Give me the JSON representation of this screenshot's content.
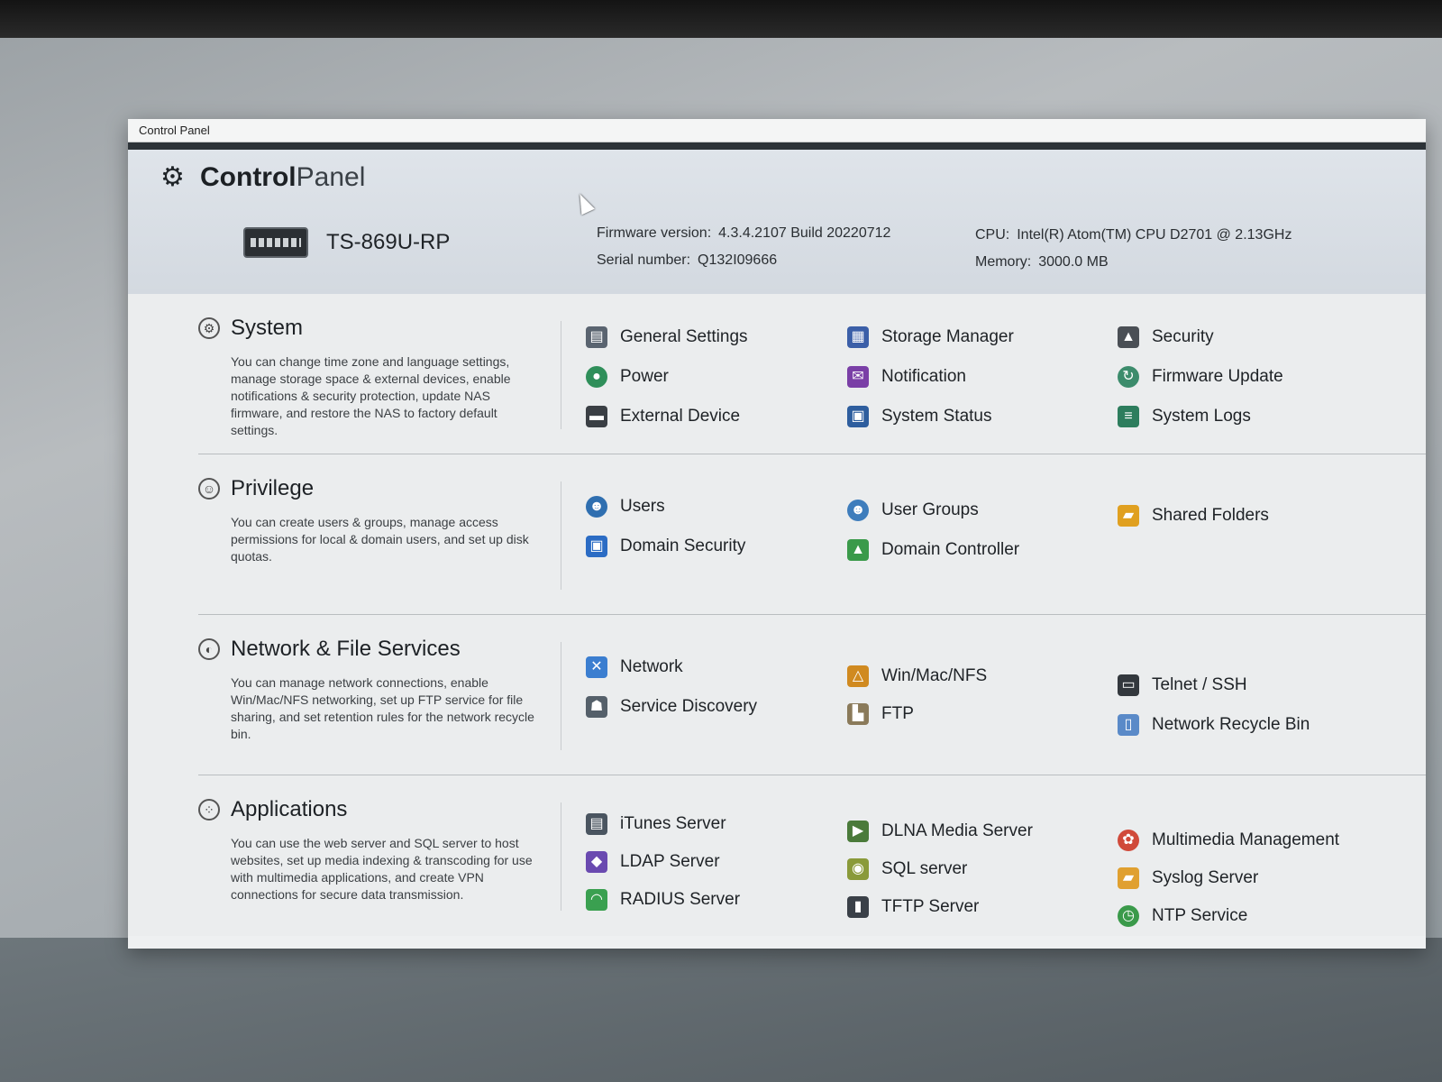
{
  "window": {
    "title": "Control Panel"
  },
  "header": {
    "app_title_bold": "Control",
    "app_title_light": "Panel",
    "device_name": "TS-869U-RP",
    "firmware_label": "Firmware version:",
    "firmware_value": "4.3.4.2107 Build 20220712",
    "serial_label": "Serial number:",
    "serial_value": "Q132I09666",
    "cpu_label": "CPU:",
    "cpu_value": "Intel(R) Atom(TM) CPU D2701 @ 2.13GHz",
    "memory_label": "Memory:",
    "memory_value": "3000.0 MB"
  },
  "sections": [
    {
      "title": "System",
      "icon": "gear-icon",
      "description": "You can change time zone and language settings, manage storage space & external devices, enable notifications & security protection, update NAS firmware, and restore the NAS to factory default settings.",
      "items": [
        {
          "label": "General Settings",
          "icon": "general-settings-icon",
          "color": "#5a6470"
        },
        {
          "label": "Power",
          "icon": "power-bulb-icon",
          "color": "#2f8f5a"
        },
        {
          "label": "External Device",
          "icon": "external-device-icon",
          "color": "#3a3f44"
        },
        {
          "label": "Storage Manager",
          "icon": "storage-manager-icon",
          "color": "#3b5fa8"
        },
        {
          "label": "Notification",
          "icon": "notification-icon",
          "color": "#7a3fa6"
        },
        {
          "label": "System Status",
          "icon": "system-status-icon",
          "color": "#2e5e9e"
        },
        {
          "label": "Security",
          "icon": "lock-icon",
          "color": "#4a4f55"
        },
        {
          "label": "Firmware Update",
          "icon": "firmware-update-icon",
          "color": "#3c8c6c"
        },
        {
          "label": "System Logs",
          "icon": "system-logs-icon",
          "color": "#2d7d5d"
        }
      ]
    },
    {
      "title": "Privilege",
      "icon": "user-outline-icon",
      "description": "You can create users & groups, manage access permissions for local & domain users, and set up disk quotas.",
      "items": [
        {
          "label": "Users",
          "icon": "users-icon",
          "color": "#2f6fb0"
        },
        {
          "label": "Domain Security",
          "icon": "domain-security-icon",
          "color": "#2b6cc4"
        },
        {
          "label": "User Groups",
          "icon": "user-groups-icon",
          "color": "#3e7dbc"
        },
        {
          "label": "Domain Controller",
          "icon": "domain-controller-icon",
          "color": "#3a9a4a"
        },
        {
          "label": "Shared Folders",
          "icon": "shared-folders-icon",
          "color": "#e0a020"
        }
      ]
    },
    {
      "title": "Network & File Services",
      "icon": "globe-icon",
      "description": "You can manage network connections, enable Win/Mac/NFS networking, set up FTP service for file sharing, and set retention rules for the network recycle bin.",
      "items": [
        {
          "label": "Network",
          "icon": "network-icon",
          "color": "#3b7ed0"
        },
        {
          "label": "Service Discovery",
          "icon": "service-discovery-icon",
          "color": "#55606a"
        },
        {
          "label": "Win/Mac/NFS",
          "icon": "win-mac-nfs-icon",
          "color": "#d08a20"
        },
        {
          "label": "FTP",
          "icon": "ftp-icon",
          "color": "#8a7a5a"
        },
        {
          "label": "Telnet / SSH",
          "icon": "terminal-icon",
          "color": "#33383d"
        },
        {
          "label": "Network Recycle Bin",
          "icon": "recycle-bin-icon",
          "color": "#5a8ac8"
        }
      ]
    },
    {
      "title": "Applications",
      "icon": "apps-grid-icon",
      "description": "You can use the web server and SQL server to host websites, set up media indexing & transcoding for use with multimedia applications, and create VPN connections for secure data transmission.",
      "items": [
        {
          "label": "iTunes Server",
          "icon": "itunes-server-icon",
          "color": "#4a5560"
        },
        {
          "label": "LDAP Server",
          "icon": "ldap-server-icon",
          "color": "#6a4ab0"
        },
        {
          "label": "RADIUS Server",
          "icon": "radius-server-icon",
          "color": "#3aa050"
        },
        {
          "label": "DLNA Media Server",
          "icon": "dlna-media-server-icon",
          "color": "#4a7a3a"
        },
        {
          "label": "SQL server",
          "icon": "sql-server-icon",
          "color": "#8a9a3a"
        },
        {
          "label": "TFTP Server",
          "icon": "tftp-server-icon",
          "color": "#3a4048"
        },
        {
          "label": "Multimedia Management",
          "icon": "multimedia-management-icon",
          "color": "#d04a3a"
        },
        {
          "label": "Syslog Server",
          "icon": "syslog-server-icon",
          "color": "#e0a030"
        },
        {
          "label": "NTP Service",
          "icon": "ntp-service-icon",
          "color": "#3a9a4a"
        }
      ]
    }
  ]
}
